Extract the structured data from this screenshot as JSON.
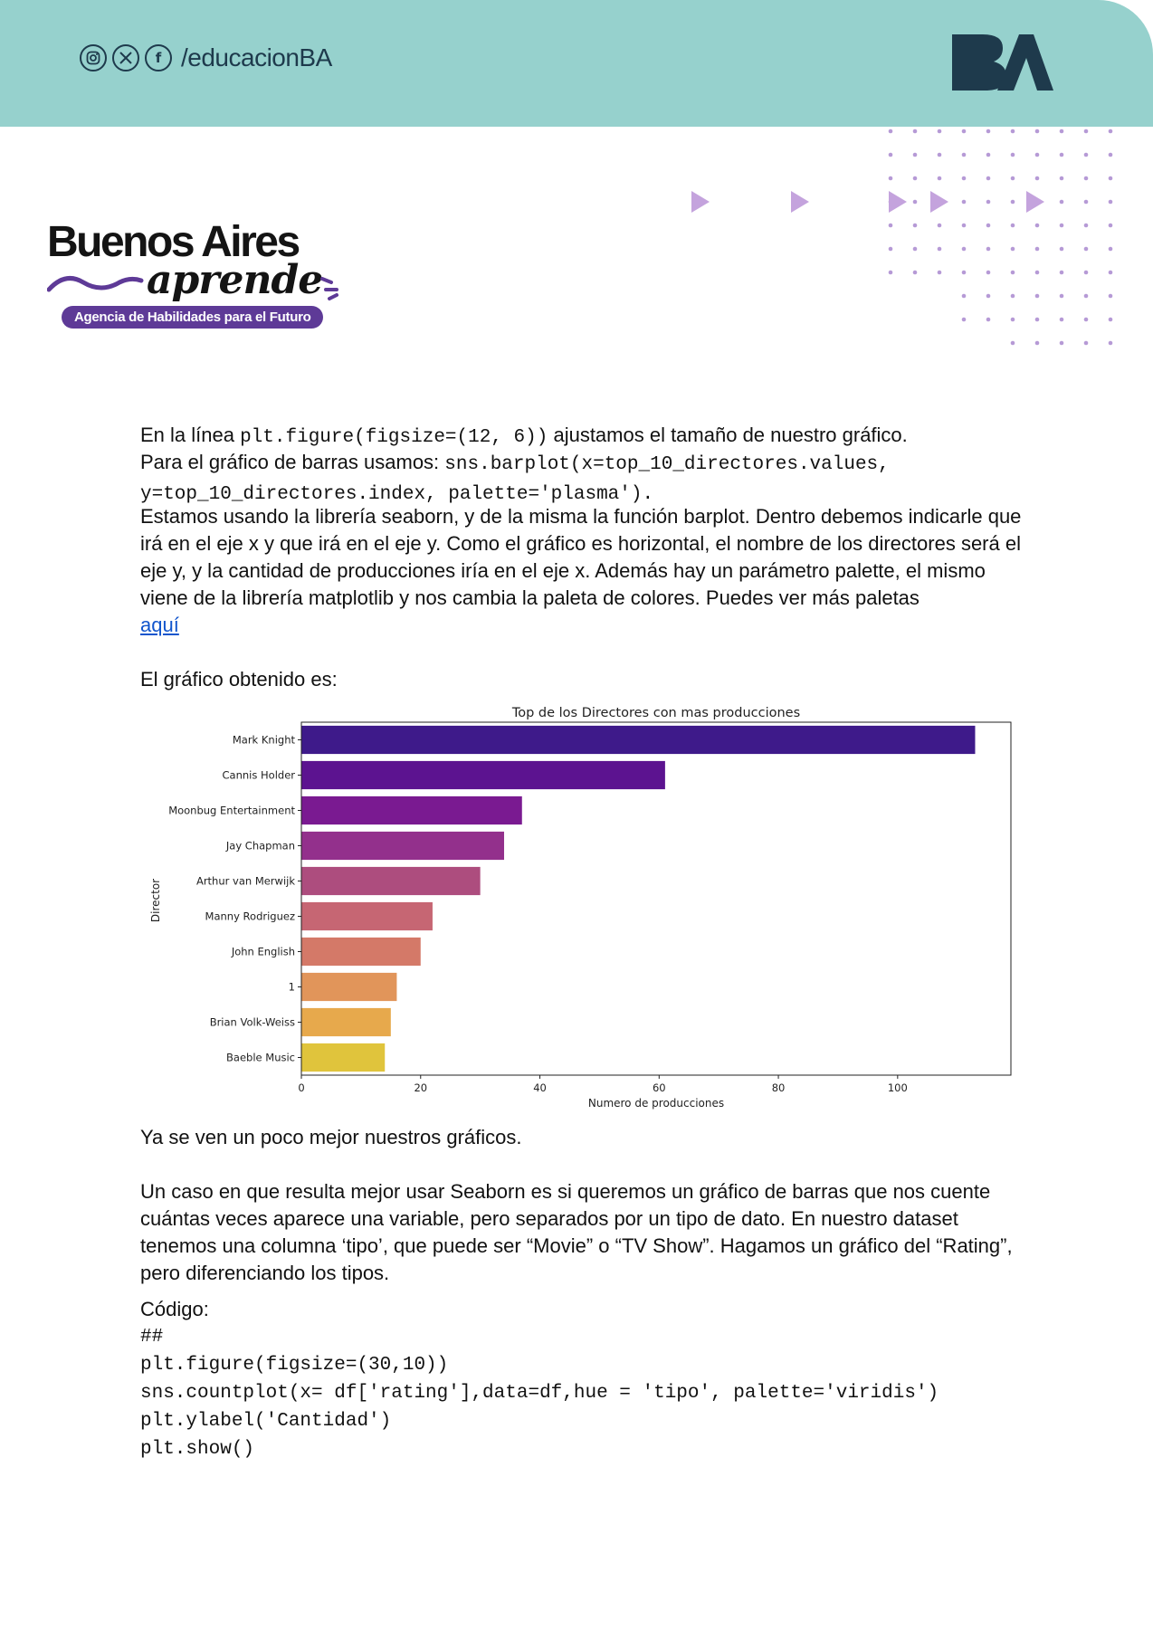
{
  "header": {
    "handle": "/educacionBA",
    "social_icons": [
      "instagram-icon",
      "x-icon",
      "facebook-icon"
    ],
    "logo": "BA",
    "bg_color": "#96d1cd",
    "text_color": "#1e3a4c"
  },
  "brand": {
    "line1": "Buenos Aires",
    "line2": "aprende",
    "tagline": "Agencia de Habilidades para el Futuro",
    "tagline_color": "#5e3a97"
  },
  "content": {
    "p1_pre": "En la línea ",
    "p1_code": "plt.figure(figsize=(12, 6))",
    "p1_post": "  ajustamos el tamaño de nuestro gráfico.",
    "p2_pre": "Para el gráfico de barras usamos: ",
    "p2_code_a": "sns.barplot(x=top_10_directores.values,",
    "p2_code_b": "y=top_10_directores.index, palette='plasma').",
    "p3": "Estamos usando la librería seaborn, y de la misma la función barplot. Dentro debemos indicarle que irá en el eje x y que irá en el eje y. Como el gráfico es horizontal, el nombre de los directores será el eje y, y la cantidad de producciones iría en el eje x. Además hay un parámetro palette, el mismo viene de la librería matplotlib y nos cambia la paleta de colores. Puedes ver más paletas",
    "link": "aquí",
    "p4": "El gráfico obtenido es:",
    "p5": "Ya se ven un poco mejor nuestros gráficos.",
    "p6": "Un caso en que resulta mejor usar Seaborn es si queremos un gráfico de barras que nos cuente cuántas veces aparece una variable, pero separados por un tipo de dato. En nuestro dataset tenemos una columna ‘tipo’, que puede ser “Movie” o “TV Show”. Hagamos un gráfico del “Rating”, pero diferenciando los tipos.",
    "code_label": "Código:",
    "code_lines": [
      "##",
      "plt.figure(figsize=(30,10))",
      "sns.countplot(x= df['rating'],data=df,hue = 'tipo', palette='viridis')",
      "plt.ylabel('Cantidad')",
      "plt.show()"
    ]
  },
  "chart_data": {
    "type": "bar",
    "orientation": "horizontal",
    "title": "Top de los Directores con mas producciones",
    "xlabel": "Numero de producciones",
    "ylabel": "Director",
    "categories": [
      "Mark Knight",
      "Cannis Holder",
      "Moonbug Entertainment",
      "Jay Chapman",
      "Arthur van Merwijk",
      "Manny Rodriguez",
      "John English",
      "1",
      "Brian Volk-Weiss",
      "Baeble Music"
    ],
    "values": [
      113,
      61,
      37,
      34,
      30,
      22,
      20,
      16,
      15,
      14
    ],
    "colors": [
      "#3e1a8a",
      "#5c1390",
      "#7a1a91",
      "#93308c",
      "#ad4d7e",
      "#c66673",
      "#d47968",
      "#e1955a",
      "#e7a94c",
      "#e0c43c"
    ],
    "xlim": [
      0,
      119
    ],
    "xticks": [
      0,
      20,
      40,
      60,
      80,
      100
    ],
    "grid": false
  }
}
